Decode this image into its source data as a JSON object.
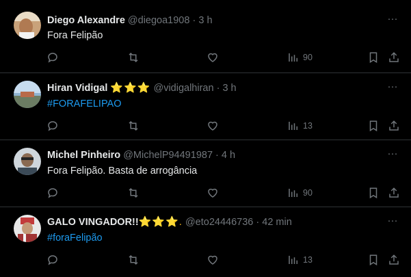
{
  "tweets": [
    {
      "name": "Diego Alexandre",
      "stars": "",
      "handle": "@diegoa1908",
      "time": "3 h",
      "text": "Fora Felipão",
      "is_hashtag": false,
      "views": "90"
    },
    {
      "name": "Hiran Vidigal",
      "stars": "⭐⭐⭐",
      "handle": "@vidigalhiran",
      "time": "3 h",
      "text": "#FORAFELIPAO",
      "is_hashtag": true,
      "views": "13"
    },
    {
      "name": "Michel Pinheiro",
      "stars": "",
      "handle": "@MichelP94491987",
      "time": "4 h",
      "text": "Fora Felipão. Basta de arrogância",
      "is_hashtag": false,
      "views": "90"
    },
    {
      "name": "GALO VINGADOR!!",
      "stars": "⭐⭐⭐.",
      "handle": "@eto24446736",
      "time": "42 min",
      "text": "#foraFelipão",
      "is_hashtag": true,
      "views": "13"
    }
  ],
  "separator": "·",
  "more_label": "···",
  "colors": {
    "background": "#000000",
    "text": "#e7e9ea",
    "muted": "#71767b",
    "link": "#1d9bf0",
    "divider": "#2f3336",
    "star": "#f4b41a"
  },
  "icons": [
    "reply-icon",
    "retweet-icon",
    "like-icon",
    "views-icon",
    "bookmark-icon",
    "share-icon",
    "more-icon"
  ]
}
